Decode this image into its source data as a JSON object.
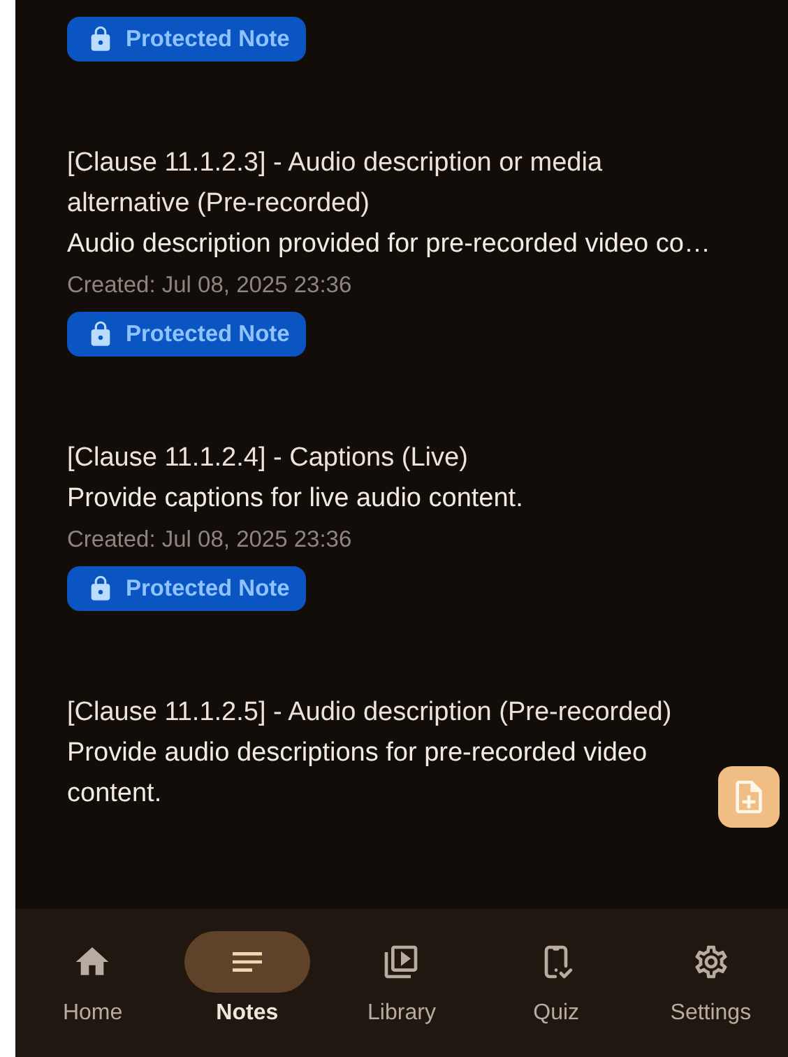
{
  "notes": [
    {
      "badge": "Protected Note"
    },
    {
      "title": "[Clause 11.1.2.3] - Audio description or media alternative (Pre-recorded)",
      "body": "Audio description provided for pre-recorded video co…",
      "created": "Created: Jul 08, 2025 23:36",
      "badge": "Protected Note"
    },
    {
      "title": "[Clause 11.1.2.4] - Captions (Live)",
      "body": "Provide captions for live audio content.",
      "created": "Created: Jul 08, 2025 23:36",
      "badge": "Protected Note"
    },
    {
      "title": "[Clause 11.1.2.5] - Audio description (Pre-recorded)",
      "body": "Provide audio descriptions for pre-recorded video content."
    }
  ],
  "nav": [
    {
      "kind": "home",
      "label": "Home",
      "selected": false
    },
    {
      "kind": "notes",
      "label": "Notes",
      "selected": true
    },
    {
      "kind": "library",
      "label": "Library",
      "selected": false
    },
    {
      "kind": "quiz",
      "label": "Quiz",
      "selected": false
    },
    {
      "kind": "settings",
      "label": "Settings",
      "selected": false
    }
  ]
}
